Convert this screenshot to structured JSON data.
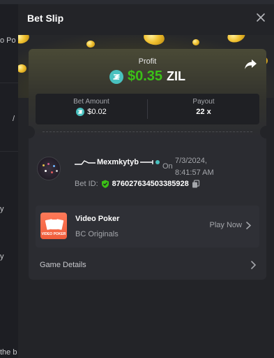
{
  "modal": {
    "title": "Bet Slip"
  },
  "profit": {
    "label": "Profit",
    "amount": "$0.35",
    "currency": "ZIL"
  },
  "bet_amount": {
    "label": "Bet Amount",
    "value": "$0.02"
  },
  "payout": {
    "label": "Payout",
    "value": "22 x"
  },
  "player": {
    "username": "Mexmkytyb",
    "on_label": "On",
    "datetime": "7/3/2024, 8:41:57 AM",
    "bet_id_label": "Bet ID:",
    "bet_id": "876027634503385928"
  },
  "game": {
    "name": "Video Poker",
    "provider": "BC Originals",
    "play_now": "Play Now",
    "thumb_label": "VIDEO POKER"
  },
  "details": {
    "label": "Game Details"
  },
  "background_fragments": {
    "f1": "o Po",
    "f2": "/",
    "f3": "y",
    "f4": "y",
    "f5": "the b"
  },
  "colors": {
    "profit_green": "#3bc117",
    "zil_teal": "#49c1bf",
    "modal_bg": "#232428",
    "card_bg": "#2b2c31"
  },
  "icons": {
    "close": "close-icon",
    "share": "share-icon",
    "zil": "zil-coin-icon",
    "shield": "shield-check-icon",
    "copy": "copy-icon",
    "chevron": "chevron-right-icon"
  }
}
